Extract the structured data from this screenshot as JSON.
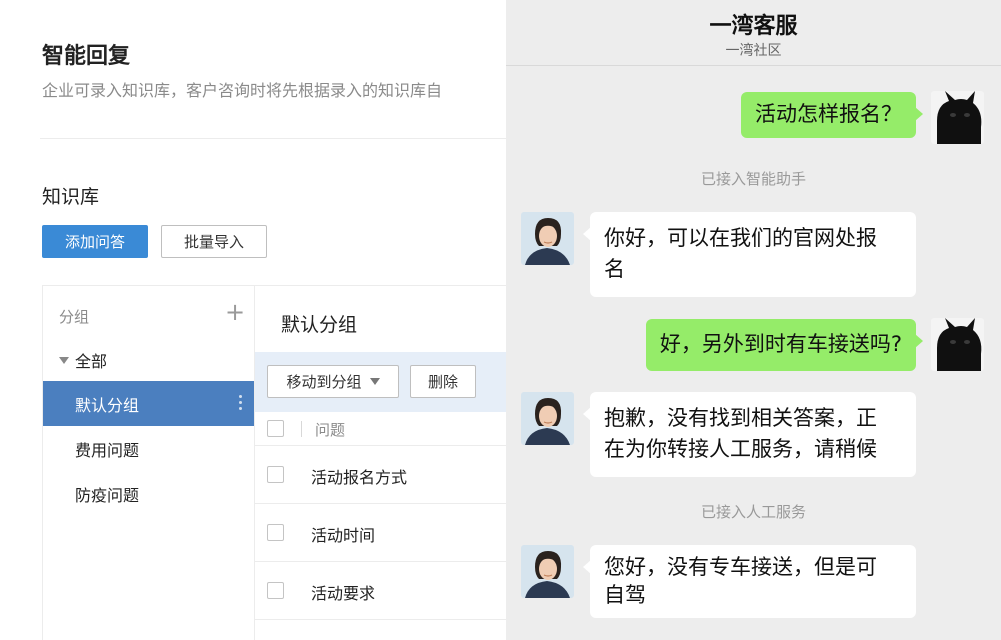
{
  "admin": {
    "title": "智能回复",
    "description": "企业可录入知识库，客户咨询时将先根据录入的知识库自",
    "knowledge_title": "知识库",
    "add_button": "添加问答",
    "import_button": "批量导入",
    "groups": {
      "header": "分组",
      "add_symbol": "+",
      "all_label": "全部",
      "items": [
        {
          "label": "默认分组",
          "active": true
        },
        {
          "label": "费用问题",
          "active": false
        },
        {
          "label": "防疫问题",
          "active": false
        }
      ]
    },
    "questions": {
      "group_title": "默认分组",
      "move_button": "移动到分组",
      "delete_button": "删除",
      "column_header": "问题",
      "rows": [
        "活动报名方式",
        "活动时间",
        "活动要求"
      ]
    }
  },
  "chat": {
    "title": "一湾客服",
    "subtitle": "一湾社区",
    "messages": [
      {
        "from": "user",
        "text": "活动怎样报名？"
      },
      {
        "system": "已接入智能助手"
      },
      {
        "from": "agent",
        "lines": [
          "你好，可以在我们的官网处报",
          "名"
        ]
      },
      {
        "from": "user",
        "text": "好，另外到时有车接送吗?"
      },
      {
        "from": "agent",
        "lines": [
          "抱歉，没有找到相关答案，正",
          "在为你转接人工服务，请稍候"
        ]
      },
      {
        "system": "已接入人工服务"
      },
      {
        "from": "agent",
        "lines": [
          "您好，没有专车接送，但是可",
          "自驾"
        ]
      }
    ]
  },
  "colors": {
    "primary_button": "#3a8ad6",
    "active_group": "#4b7fbf",
    "toolbar_bg": "#e6eef8",
    "chat_bg": "#ededed",
    "user_bubble": "#95ec69",
    "agent_bubble": "#ffffff"
  },
  "icons": {
    "user_avatar": "black-cat-avatar-icon",
    "agent_avatar": "agent-portrait-avatar-icon"
  }
}
